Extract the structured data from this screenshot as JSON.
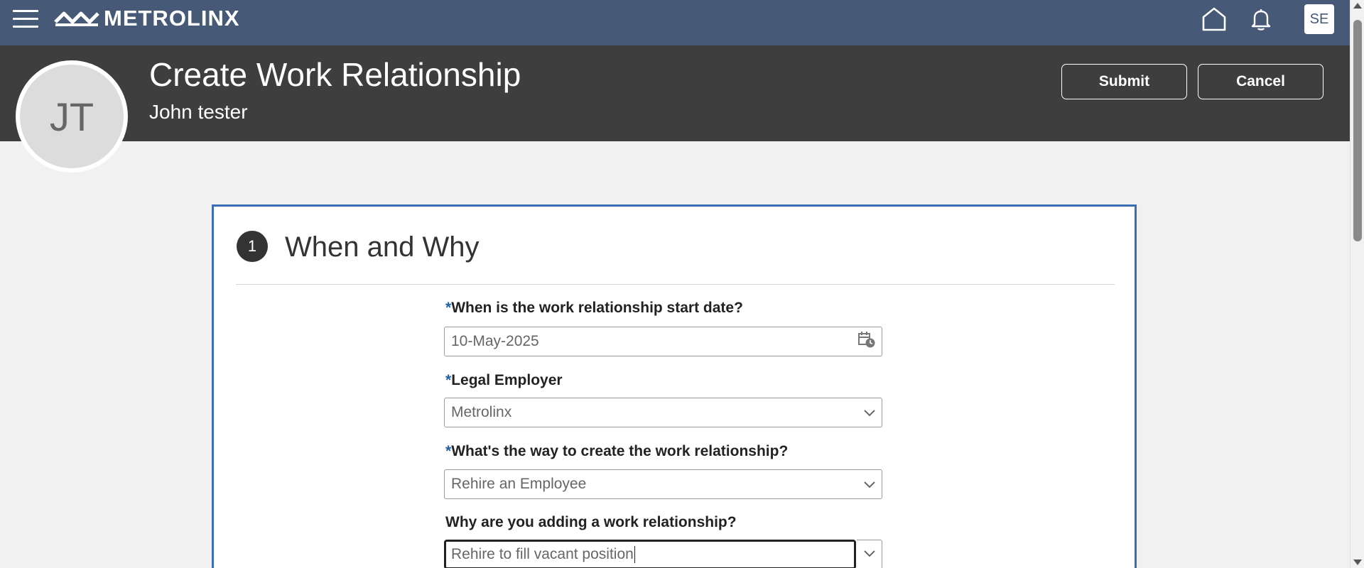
{
  "app": {
    "logo_text": "METROLINX",
    "user_initials": "SE"
  },
  "header": {
    "title": "Create Work Relationship",
    "subtitle": "John tester",
    "avatar_initials": "JT",
    "submit_label": "Submit",
    "cancel_label": "Cancel"
  },
  "step": {
    "number": "1",
    "title": "When and Why",
    "fields": [
      {
        "required": true,
        "label": "When is the work relationship start date?",
        "value": "10-May-2025",
        "icon": "calendar-icon"
      },
      {
        "required": true,
        "label": "Legal Employer",
        "value": "Metrolinx",
        "icon": "chevron-down-icon"
      },
      {
        "required": true,
        "label": "What's the way to create the work relationship?",
        "value": "Rehire an Employee",
        "icon": "chevron-down-icon"
      },
      {
        "required": false,
        "label": "Why are you adding a work relationship?",
        "value": "Rehire to fill vacant position",
        "icon": "chevron-down-icon"
      }
    ]
  },
  "required_marker": "*",
  "colors": {
    "topbar": "#465a78",
    "header": "#3e3e3e",
    "card_border": "#3a6fb5",
    "required": "#1f5fa6"
  }
}
